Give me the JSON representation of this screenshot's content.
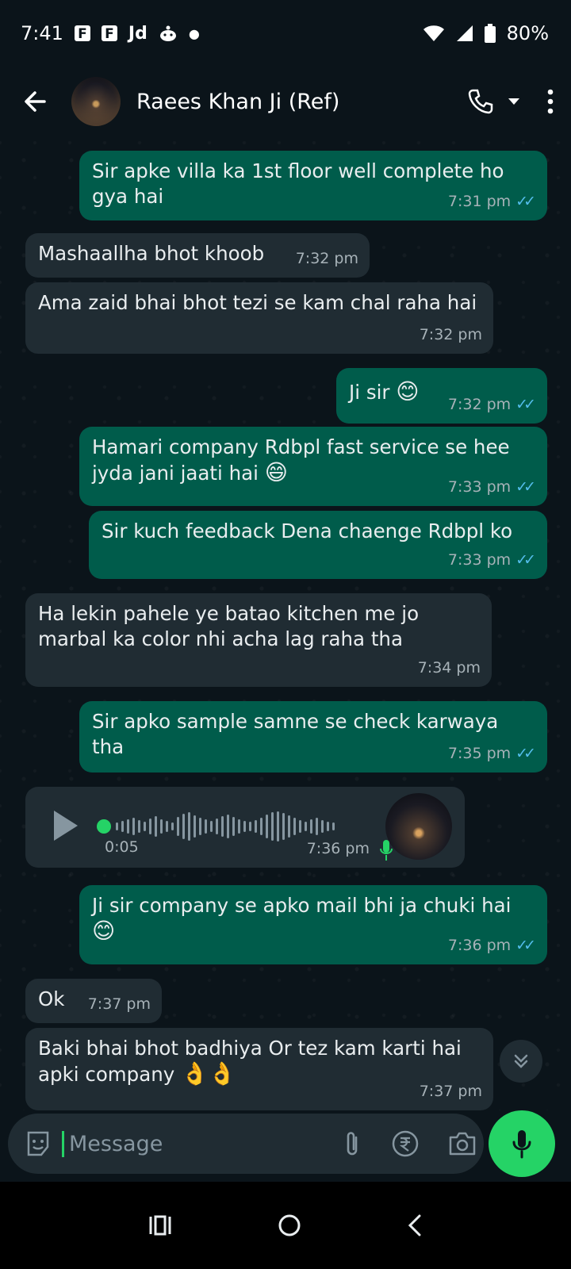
{
  "status_bar": {
    "time": "7:41",
    "app_icons": [
      "F",
      "F",
      "Jd"
    ],
    "battery": "80%"
  },
  "header": {
    "contact_name": "Raees Khan Ji (Ref)"
  },
  "messages": [
    {
      "dir": "out",
      "text": "Sir apke villa ka 1st floor well complete ho gya hai",
      "time": "7:31 pm"
    },
    {
      "dir": "in",
      "text": "Mashaallha bhot khoob",
      "time": "7:32 pm"
    },
    {
      "dir": "in",
      "text": "Ama zaid bhai bhot tezi se kam chal raha hai",
      "time": "7:32 pm"
    },
    {
      "dir": "out",
      "text": "Ji sir",
      "emoji": "😊",
      "time": "7:32 pm"
    },
    {
      "dir": "out",
      "text": "Hamari company Rdbpl fast service se hee jyda jani jaati hai",
      "emoji": "😄",
      "time": "7:33 pm"
    },
    {
      "dir": "out",
      "text": "Sir kuch feedback Dena chaenge Rdbpl ko",
      "time": "7:33 pm"
    },
    {
      "dir": "in",
      "text": "Ha lekin pahele ye batao kitchen me jo marbal ka color nhi acha lag raha tha",
      "time": "7:34 pm"
    },
    {
      "dir": "out",
      "text": "Sir apko sample samne se check karwaya tha",
      "time": "7:35 pm"
    },
    {
      "dir": "in",
      "type": "voice",
      "duration": "0:05",
      "time": "7:36 pm"
    },
    {
      "dir": "out",
      "text": "Ji sir company se apko mail bhi ja chuki hai",
      "emoji": "😊",
      "time": "7:36 pm"
    },
    {
      "dir": "in",
      "text": "Ok",
      "time": "7:37 pm"
    },
    {
      "dir": "in",
      "text": "Baki bhai bhot badhiya Or tez kam karti hai apki company",
      "emoji": "👌👌",
      "time": "7:37 pm"
    }
  ],
  "input": {
    "placeholder": "Message"
  },
  "colors": {
    "background": "#0b141a",
    "outgoing_bubble": "#005c4b",
    "incoming_bubble": "#202c33",
    "accent": "#25d366",
    "read_tick": "#53bdeb"
  }
}
